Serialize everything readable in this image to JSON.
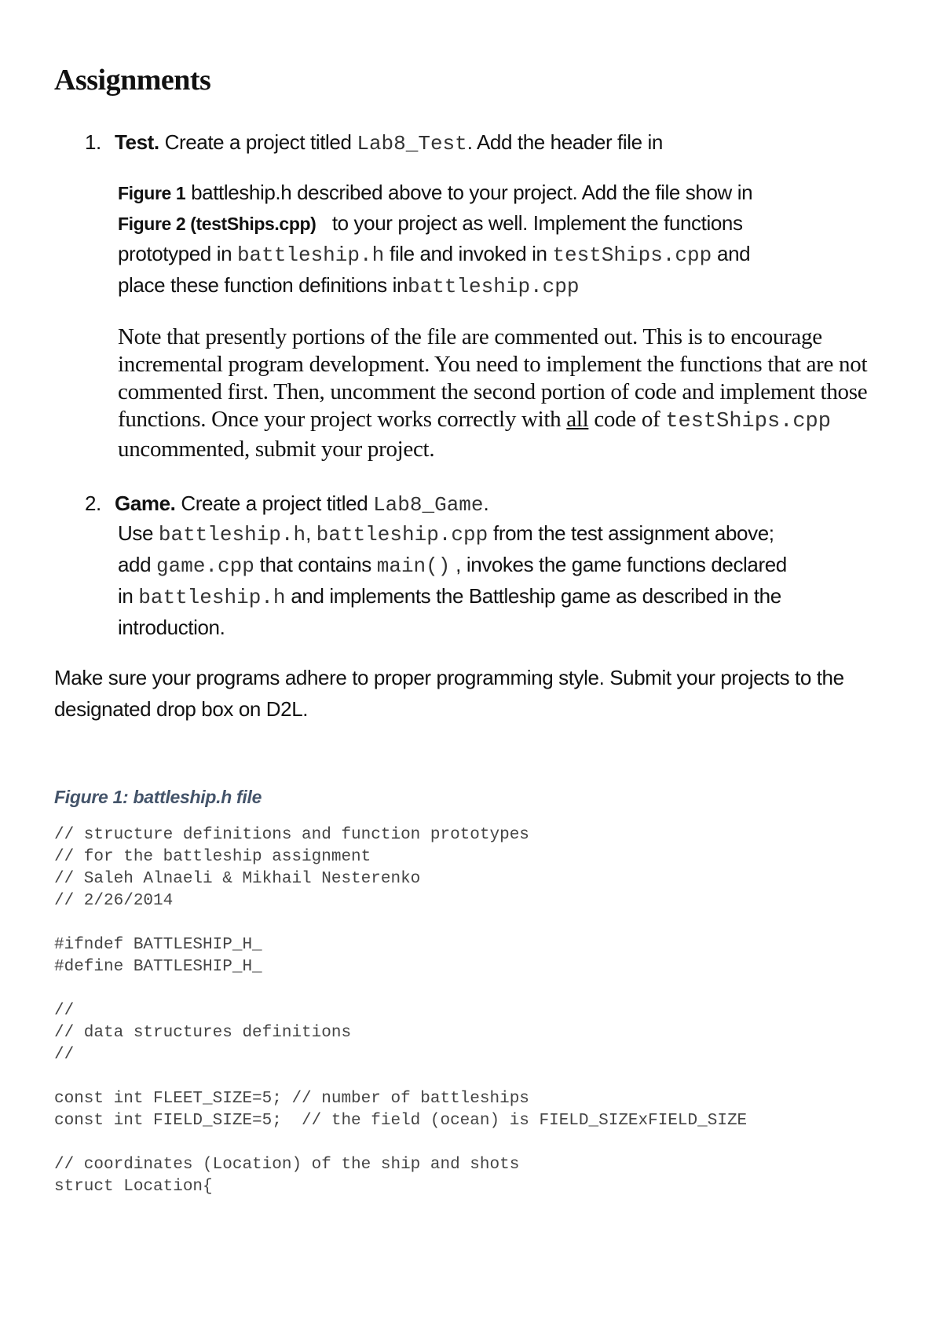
{
  "heading": "Assignments",
  "items": [
    {
      "number": "1.",
      "label": "Test.",
      "text_before": " Create a project titled ",
      "project_name": "Lab8_Test",
      "text_after": ". Add the header file in",
      "para": {
        "fig1_ref": "Figure 1",
        "t1": " battleship.h described above to your project. Add the file show in",
        "fig2_ref": "Figure 2 (testShips.cpp)",
        "t2": "   to your project as well. Implement the functions",
        "t3": "prototyped in ",
        "c1": "battleship.h",
        "t4": " file and invoked in ",
        "c2": "testShips.cpp",
        "t5": " and",
        "t6": "place these function definitions in",
        "c3": "battleship.cpp"
      },
      "note": {
        "t1": "Note that presently portions of the file are commented out. This is to encourage incremental program development. You need to implement the functions that are not commented first. Then, uncomment the second portion of code and implement those functions. Once your project works correctly with ",
        "underlined": "all",
        "t2": " code of ",
        "code": "testShips.cpp",
        "t3": " uncommented, submit your project."
      }
    },
    {
      "number": "2.",
      "label": "Game.",
      "text_before": " Create a project titled ",
      "project_name": "Lab8_Game",
      "text_after": ".",
      "para": {
        "t1": "Use ",
        "c1": "battleship.h",
        "t2": ", ",
        "c2": "battleship.cpp",
        "t3": " from the test assignment above;",
        "t4": "add ",
        "c3": "game.cpp",
        "t5": " that contains ",
        "c4": "main()",
        "t6": " , invokes the game functions declared",
        "t7": "in ",
        "c5": "battleship.h",
        "t8": " and implements the Battleship game as described in the",
        "t9": "introduction."
      }
    }
  ],
  "outro": "Make sure your programs adhere to proper programming style. Submit your projects to the designated drop box on D2L.",
  "figure": {
    "caption": "Figure 1: battleship.h  file",
    "code_lines": [
      "// structure definitions and function prototypes",
      "// for the battleship assignment",
      "// Saleh Alnaeli & Mikhail Nesterenko",
      "// 2/26/2014",
      "",
      "#ifndef BATTLESHIP_H_",
      "#define BATTLESHIP_H_",
      "",
      "//",
      "// data structures definitions",
      "//",
      "",
      "const int FLEET_SIZE=5; // number of battleships",
      "const int FIELD_SIZE=5;  // the field (ocean) is FIELD_SIZExFIELD_SIZE",
      "",
      "// coordinates (Location) of the ship and shots",
      "struct Location{"
    ]
  },
  "colors": {
    "caption": "#44546a",
    "text": "#111111"
  }
}
